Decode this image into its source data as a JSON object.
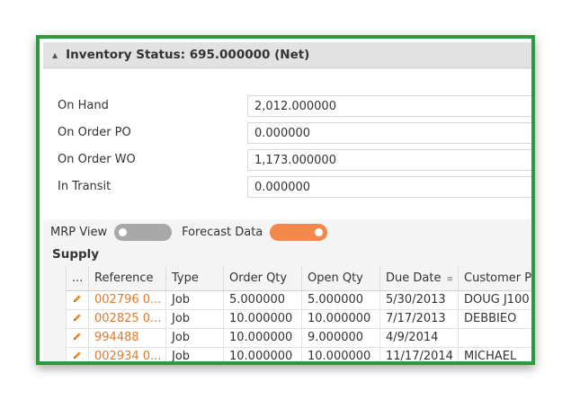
{
  "section": {
    "title": "Inventory Status: 695.000000 (Net)"
  },
  "fields": [
    {
      "label": "On Hand",
      "value": "2,012.000000"
    },
    {
      "label": "On Order PO",
      "value": "0.000000"
    },
    {
      "label": "On Order WO",
      "value": "1,173.000000"
    },
    {
      "label": "In Transit",
      "value": "0.000000"
    }
  ],
  "toggles": {
    "mrp_view": {
      "label": "MRP View",
      "state": "off"
    },
    "forecast_data": {
      "label": "Forecast Data",
      "state": "on"
    }
  },
  "supply": {
    "title": "Supply",
    "columns": [
      "...",
      "Reference",
      "Type",
      "Order Qty",
      "Open Qty",
      "Due Date",
      "Customer P"
    ],
    "rows": [
      {
        "reference": "002796 0...",
        "type": "Job",
        "order_qty": "5.000000",
        "open_qty": "5.000000",
        "due_date": "5/30/2013",
        "customer": "DOUG J100"
      },
      {
        "reference": "002825 0...",
        "type": "Job",
        "order_qty": "10.000000",
        "open_qty": "10.000000",
        "due_date": "7/17/2013",
        "customer": "DEBBIEO"
      },
      {
        "reference": "994488",
        "type": "Job",
        "order_qty": "10.000000",
        "open_qty": "9.000000",
        "due_date": "4/9/2014",
        "customer": ""
      },
      {
        "reference": "002934 0...",
        "type": "Job",
        "order_qty": "10.000000",
        "open_qty": "10.000000",
        "due_date": "11/17/2014",
        "customer": "MICHAEL"
      }
    ]
  },
  "colors": {
    "frame": "#2e9a3f",
    "accent": "#f4874b",
    "link": "#e07a2d"
  }
}
